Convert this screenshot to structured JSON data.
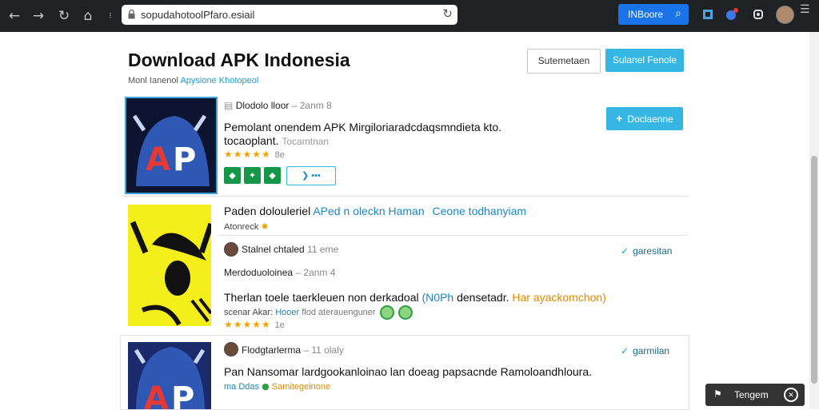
{
  "browser": {
    "url": "sopudahotoolPfaro.esiail",
    "search_label": "INBoore",
    "icons": [
      "back-icon",
      "forward-icon",
      "reload-icon",
      "home-icon",
      "lock-icon",
      "refresh-icon",
      "search-icon",
      "extension-icon",
      "menu-icon"
    ]
  },
  "header": {
    "title": "Download APK Indonesia",
    "subtitle_plain": "Monl Ianenol",
    "subtitle_accent": "Apysione Khotopeol",
    "btn_outline": "Sutemetaen",
    "btn_primary": "Sulanel Fenole"
  },
  "items": [
    {
      "meta_name": "Dlodolo lloor",
      "meta_detail": "– 2anm 8",
      "desc_line1": "Pemolant onendem APK Mirgiloriaradcdaqsmndieta kto.",
      "desc_line2": "tocaoplant.",
      "desc_line2_gray": "Tocamtnan",
      "stars": "★★★★★",
      "reviews": "8e",
      "download_label": "Doclaenne",
      "share_label": "❯  •••"
    },
    {
      "headline": "Paden dolouleriel",
      "headline_link1": "APed n oleckn Haman",
      "headline_link2": "Ceone todhanyiam",
      "tag": "Atonreck",
      "author": "Stalnel chtaled",
      "author_detail": "11 eme",
      "verified_label": "garesitan",
      "meta_name": "Merdoduoloinea",
      "meta_detail": "– 2anm 4",
      "desc": "Therlan toele taerkleuen non derkadoal",
      "desc_link": "(N0Ph",
      "desc_mid": "densetadr.",
      "desc_orange": "Har ayackomchon)",
      "small_plain": "scenar Akar:",
      "small_link": "Hooer",
      "small_gray": "flod aterauenguner",
      "stars": "★★★★★",
      "reviews": "1e"
    },
    {
      "author": "Flodgtarlerma",
      "author_detail": "– 11 olaly",
      "verified_label": "garmilan",
      "desc": "Pan Nansomar lardgookanloinao lan doeag papsacnde Ramoloandhloura.",
      "small_link": "ma Ddas",
      "small_green": "Samitegeinone"
    }
  ],
  "toast": {
    "label": "Tengem"
  },
  "colors": {
    "accent": "#36b7e3",
    "green": "#159648",
    "star": "#f0a400",
    "chrome": "#202124"
  }
}
